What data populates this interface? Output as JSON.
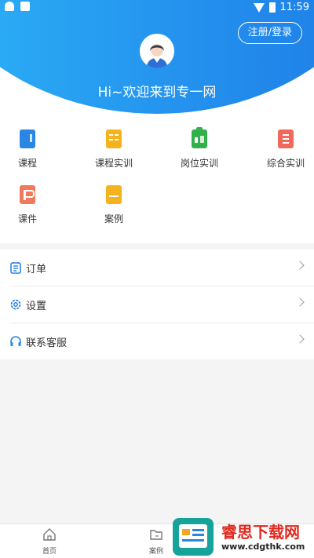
{
  "statusbar": {
    "time": "11:59"
  },
  "header": {
    "login_label": "注册/登录",
    "greeting": "Hi~欢迎来到专一网"
  },
  "grid": {
    "items": [
      {
        "label": "课程",
        "icon": "course-icon",
        "color": "#2a86e5"
      },
      {
        "label": "课程实训",
        "icon": "course-training-icon",
        "color": "#f5b21c"
      },
      {
        "label": "岗位实训",
        "icon": "job-training-icon",
        "color": "#32b04a"
      },
      {
        "label": "综合实训",
        "icon": "comprehensive-training-icon",
        "color": "#f0695a"
      },
      {
        "label": "课件",
        "icon": "courseware-icon",
        "color": "#f07a5e"
      },
      {
        "label": "案例",
        "icon": "case-icon",
        "color": "#f5b21c"
      }
    ]
  },
  "menu": {
    "items": [
      {
        "label": "订单",
        "icon": "order-icon"
      },
      {
        "label": "设置",
        "icon": "settings-icon"
      },
      {
        "label": "联系客服",
        "icon": "headset-icon"
      }
    ],
    "accent": "#2a86e5"
  },
  "bottomnav": {
    "items": [
      {
        "label": "首页",
        "icon": "home-icon"
      },
      {
        "label": "案例",
        "icon": "folder-icon"
      }
    ]
  },
  "watermark": {
    "title": "睿思下载网",
    "url": "www.cdgthk.com"
  }
}
